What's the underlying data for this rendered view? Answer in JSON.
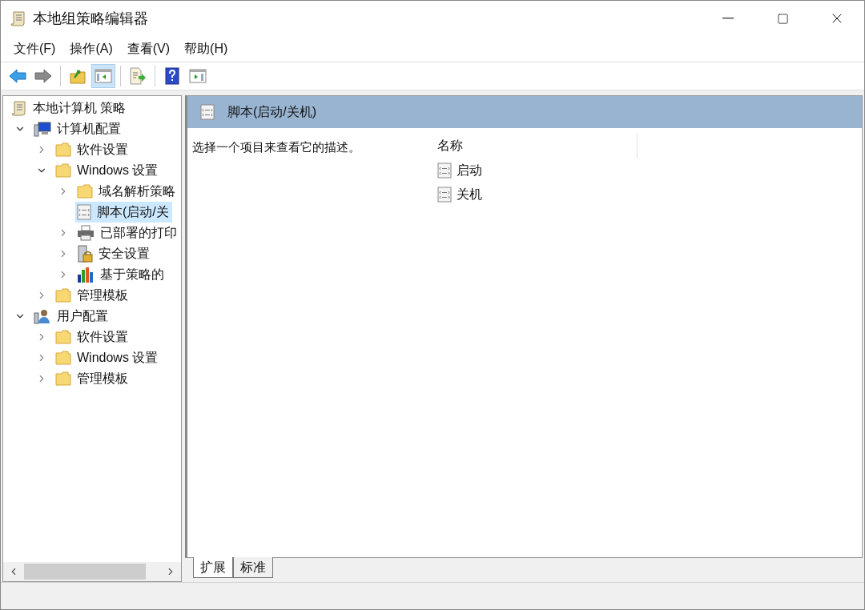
{
  "window": {
    "title": "本地组策略编辑器"
  },
  "menu": [
    "文件(F)",
    "操作(A)",
    "查看(V)",
    "帮助(H)"
  ],
  "toolbar": [
    {
      "kind": "back",
      "pressed": false
    },
    {
      "kind": "forward",
      "pressed": false
    },
    {
      "kind": "sep"
    },
    {
      "kind": "up",
      "pressed": false
    },
    {
      "kind": "tree",
      "pressed": true
    },
    {
      "kind": "sep"
    },
    {
      "kind": "export",
      "pressed": false
    },
    {
      "kind": "sep"
    },
    {
      "kind": "help",
      "pressed": false
    },
    {
      "kind": "action",
      "pressed": false
    }
  ],
  "tree": [
    {
      "label": "本地计算机 策略",
      "kind": "scroll",
      "selected": false,
      "children": [
        {
          "label": "计算机配置",
          "kind": "computer",
          "expanded": true,
          "selected": false,
          "children": [
            {
              "label": "软件设置",
              "kind": "folder",
              "expanded": false,
              "selected": false
            },
            {
              "label": "Windows 设置",
              "kind": "folder",
              "expanded": true,
              "selected": false,
              "children": [
                {
                  "label": "域名解析策略",
                  "kind": "folder",
                  "expanded": false,
                  "selected": false
                },
                {
                  "label": "脚本(启动/关",
                  "kind": "script",
                  "selected": true
                },
                {
                  "label": "已部署的打印",
                  "kind": "printer",
                  "expanded": false,
                  "selected": false
                },
                {
                  "label": "安全设置",
                  "kind": "security",
                  "expanded": false,
                  "selected": false
                },
                {
                  "label": "基于策略的",
                  "kind": "chart",
                  "expanded": false,
                  "selected": false
                }
              ]
            },
            {
              "label": "管理模板",
              "kind": "folder",
              "expanded": false,
              "selected": false
            }
          ]
        },
        {
          "label": "用户配置",
          "kind": "user",
          "expanded": true,
          "selected": false,
          "children": [
            {
              "label": "软件设置",
              "kind": "folder",
              "expanded": false,
              "selected": false
            },
            {
              "label": "Windows 设置",
              "kind": "folder",
              "expanded": false,
              "selected": false
            },
            {
              "label": "管理模板",
              "kind": "folder",
              "expanded": false,
              "selected": false
            }
          ]
        }
      ]
    }
  ],
  "details": {
    "title": "脚本(启动/关机)",
    "description": "选择一个项目来查看它的描述。",
    "columns": [
      "名称"
    ],
    "items": [
      "启动",
      "关机"
    ]
  },
  "tabs": [
    {
      "label": "扩展",
      "selected": true
    },
    {
      "label": "标准",
      "selected": false
    }
  ]
}
